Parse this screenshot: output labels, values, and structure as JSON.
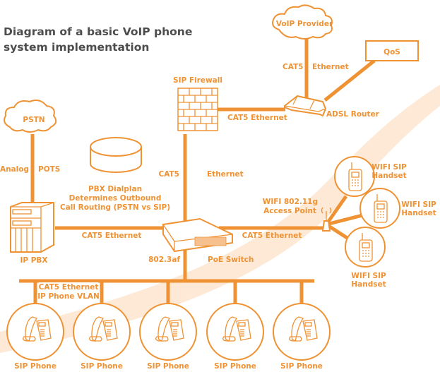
{
  "title": {
    "line1": "Diagram of a basic VoIP phone",
    "line2": "system implementation"
  },
  "colors": {
    "accent": "#ef9234",
    "title": "#4d4d4d",
    "swoosh": "#fde9d6",
    "background": "#ffffff"
  },
  "nodes": {
    "voip_provider": {
      "label": "VoIP Provider",
      "icon": "cloud-icon"
    },
    "qos": {
      "label": "QoS",
      "icon": "box"
    },
    "adsl_router": {
      "label": "ADSL Router",
      "icon": "router-icon"
    },
    "sip_firewall": {
      "label": "SIP Firewall",
      "icon": "brick-wall-icon"
    },
    "pstn": {
      "label": "PSTN",
      "icon": "cloud-icon"
    },
    "dialplan": {
      "lines": [
        "PBX Dialplan",
        "Determines Outbound",
        "Call Routing (PSTN vs SIP)"
      ],
      "icon": "database-cylinder-icon"
    },
    "ip_pbx": {
      "label": "IP PBX",
      "icon": "server-tower-icon"
    },
    "poe_switch": {
      "label_left": "802.3af",
      "label_right": "PoE Switch",
      "icon": "network-switch-icon"
    },
    "access_point": {
      "line1": "WIFI 802.11g",
      "line2": "Access Point",
      "icon": "wifi-antenna-icon"
    },
    "wifi_handsets": [
      {
        "line1": "WIFI SIP",
        "line2": "Handset",
        "icon": "mobile-phone-icon"
      },
      {
        "line1": "WIFI SIP",
        "line2": "Handset",
        "icon": "mobile-phone-icon"
      },
      {
        "line1": "WIFI SIP",
        "line2": "Handset",
        "icon": "mobile-phone-icon"
      }
    ],
    "sip_phones": [
      {
        "label": "SIP Phone",
        "icon": "desk-phone-icon"
      },
      {
        "label": "SIP Phone",
        "icon": "desk-phone-icon"
      },
      {
        "label": "SIP Phone",
        "icon": "desk-phone-icon"
      },
      {
        "label": "SIP Phone",
        "icon": "desk-phone-icon"
      },
      {
        "label": "SIP Phone",
        "icon": "desk-phone-icon"
      }
    ]
  },
  "links": {
    "provider_router": {
      "left": "CAT5",
      "right": "Ethernet"
    },
    "firewall_router": {
      "label": "CAT5 Ethernet"
    },
    "firewall_switch": {
      "left": "CAT5",
      "right": "Ethernet"
    },
    "pstn_pbx": {
      "left": "Analog",
      "right": "POTS"
    },
    "pbx_switch": {
      "label": "CAT5 Ethernet"
    },
    "switch_ap": {
      "label": "CAT5 Ethernet"
    },
    "phone_bus": {
      "line1": "CAT5 Ethernet",
      "line2": "IP Phone VLAN"
    }
  }
}
